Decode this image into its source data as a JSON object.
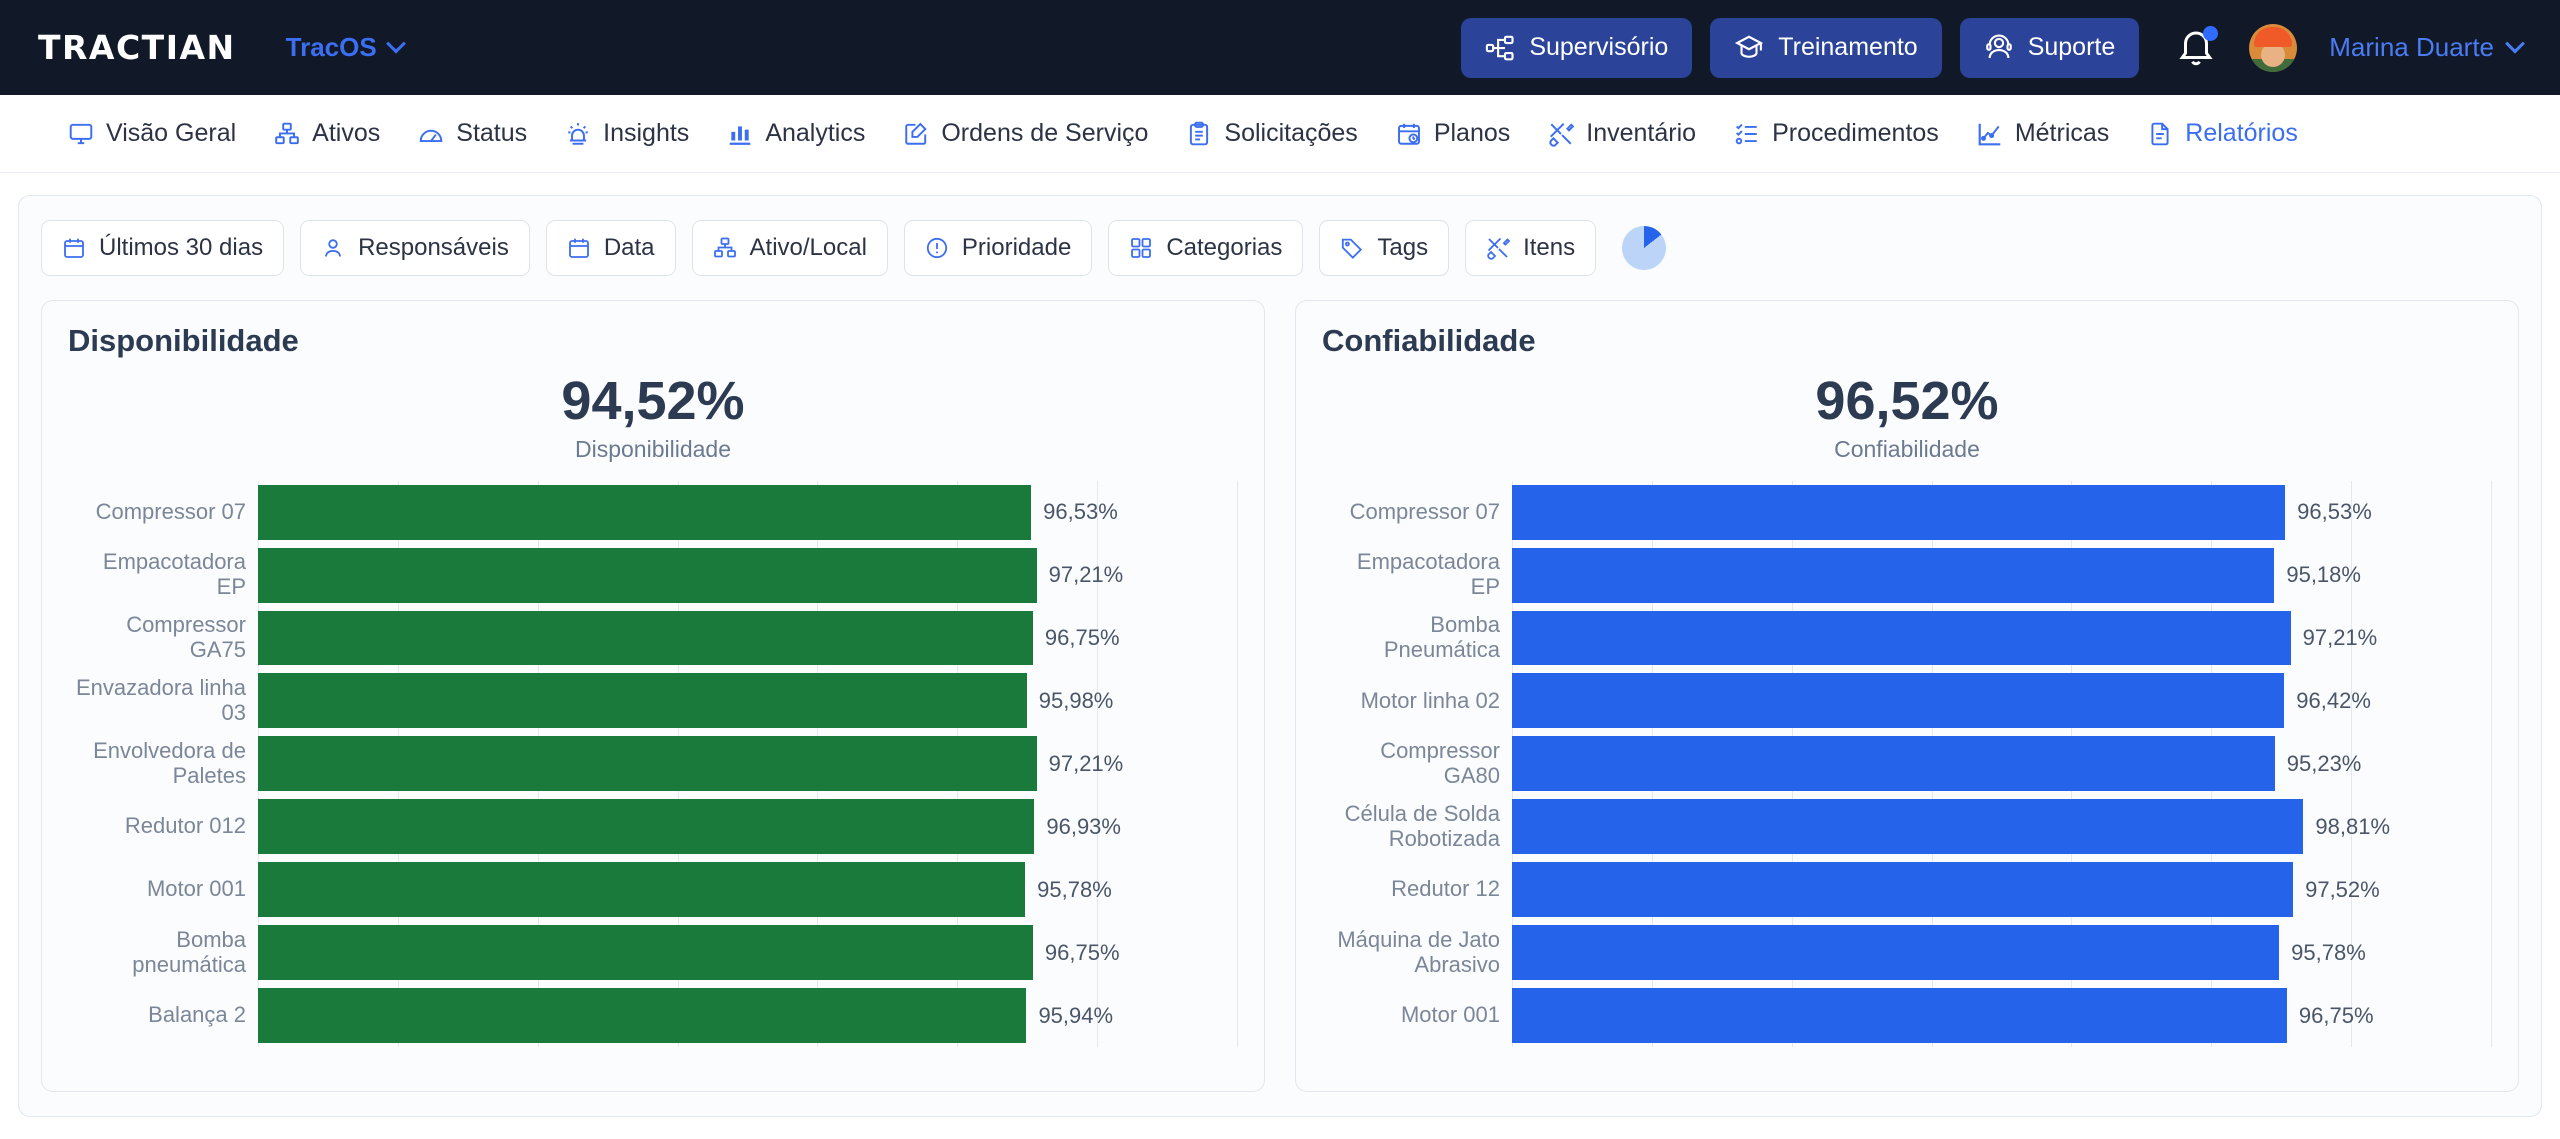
{
  "header": {
    "logo": "TRACTIAN",
    "product": "TracOS",
    "buttons": [
      {
        "label": "Supervisório",
        "icon": "supervisory-icon"
      },
      {
        "label": "Treinamento",
        "icon": "graduation-cap-icon"
      },
      {
        "label": "Suporte",
        "icon": "support-agent-icon"
      }
    ],
    "notification_icon": "bell-icon",
    "user": "Marina Duarte",
    "colors": {
      "bar_bg": "#111827",
      "accent": "#3b6ef0",
      "pill": "#2b4398"
    }
  },
  "nav": {
    "items": [
      {
        "label": "Visão Geral",
        "icon": "monitor-icon",
        "active": false
      },
      {
        "label": "Ativos",
        "icon": "assets-tree-icon",
        "active": false
      },
      {
        "label": "Status",
        "icon": "gauge-icon",
        "active": false
      },
      {
        "label": "Insights",
        "icon": "siren-icon",
        "active": false
      },
      {
        "label": "Analytics",
        "icon": "bar-chart-icon",
        "active": false
      },
      {
        "label": "Ordens de Serviço",
        "icon": "edit-square-icon",
        "active": false
      },
      {
        "label": "Solicitações",
        "icon": "clipboard-icon",
        "active": false
      },
      {
        "label": "Planos",
        "icon": "calendar-clock-icon",
        "active": false
      },
      {
        "label": "Inventário",
        "icon": "tools-icon",
        "active": false
      },
      {
        "label": "Procedimentos",
        "icon": "checklist-icon",
        "active": false
      },
      {
        "label": "Métricas",
        "icon": "line-chart-icon",
        "active": false
      },
      {
        "label": "Relatórios",
        "icon": "document-icon",
        "active": true
      }
    ]
  },
  "filters": {
    "items": [
      {
        "label": "Últimos 30 dias",
        "icon": "calendar-icon"
      },
      {
        "label": "Responsáveis",
        "icon": "user-icon"
      },
      {
        "label": "Data",
        "icon": "calendar-icon"
      },
      {
        "label": "Ativo/Local",
        "icon": "assets-tree-icon"
      },
      {
        "label": "Prioridade",
        "icon": "exclamation-circle-icon"
      },
      {
        "label": "Categorias",
        "icon": "grid-squares-icon"
      },
      {
        "label": "Tags",
        "icon": "tag-icon"
      },
      {
        "label": "Itens",
        "icon": "tools-icon"
      }
    ],
    "progress_indicator": "pie-progress-icon"
  },
  "chart_data": [
    {
      "type": "bar",
      "orientation": "horizontal",
      "title": "Disponibilidade",
      "kpi_value": "94,52%",
      "kpi_label": "Disponibilidade",
      "color": "#1a7a3c",
      "xlabel": "",
      "ylabel": "",
      "grid": true,
      "xlim": [
        0,
        100
      ],
      "categories": [
        "Compressor 07",
        "Empacotadora EP",
        "Compressor GA75",
        "Envazadora linha 03",
        "Envolvedora de Paletes",
        "Redutor 012",
        "Motor 001",
        "Bomba pneumática",
        "Balança 2"
      ],
      "values": [
        96.53,
        97.21,
        96.75,
        95.98,
        97.21,
        96.93,
        95.78,
        96.75,
        95.94
      ],
      "value_labels": [
        "96,53%",
        "97,21%",
        "96,75%",
        "95,98%",
        "97,21%",
        "96,93%",
        "95,78%",
        "96,75%",
        "95,94%"
      ]
    },
    {
      "type": "bar",
      "orientation": "horizontal",
      "title": "Confiabilidade",
      "kpi_value": "96,52%",
      "kpi_label": "Confiabilidade",
      "color": "#2563eb",
      "xlabel": "",
      "ylabel": "",
      "grid": true,
      "xlim": [
        0,
        100
      ],
      "categories": [
        "Compressor 07",
        "Empacotadora EP",
        "Bomba Pneumática",
        "Motor linha 02",
        "Compressor GA80",
        "Célula de Solda Robotizada",
        "Redutor 12",
        "Máquina de Jato Abrasivo",
        "Motor 001"
      ],
      "values": [
        96.53,
        95.18,
        97.21,
        96.42,
        95.23,
        98.81,
        97.52,
        95.78,
        96.75
      ],
      "value_labels": [
        "96,53%",
        "95,18%",
        "97,21%",
        "96,42%",
        "95,23%",
        "98,81%",
        "97,52%",
        "95,78%",
        "96,75%"
      ]
    }
  ]
}
